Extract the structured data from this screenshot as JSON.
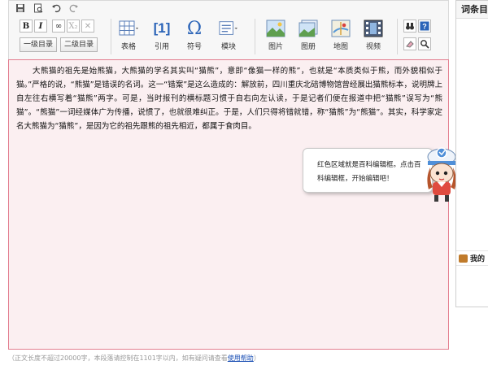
{
  "quickbar": {
    "icons": [
      "save-icon",
      "preview-icon",
      "undo-icon",
      "redo-icon"
    ]
  },
  "toolbar": {
    "format": {
      "bold": "B",
      "italic": "I",
      "link": "∞",
      "subscript": "X₂",
      "clear": "✕"
    },
    "heading1_label": "一级目录",
    "heading2_label": "二级目录",
    "table_label": "表格",
    "cite_label": "引用",
    "cite_glyph": "[1]",
    "symbol_label": "符号",
    "symbol_glyph": "Ω",
    "module_label": "模块",
    "image_label": "图片",
    "album_label": "图册",
    "map_label": "地图",
    "video_label": "视频"
  },
  "content": {
    "paragraph": "大熊猫的祖先是始熊猫，大熊猫的学名其实叫“猫熊”，意即“像猫一样的熊”，也就是“本质类似于熊，而外貌相似于猫。”严格的说，“熊猫”是错误的名词。这一“错案”是这么造成的：解放前，四川重庆北碚博物馆曾经展出猫熊标本，说明牌上自左往右横写着“猫熊”两字。可是，当时报刊的横标题习惯于自右向左认读，于是记者们便在报道中把“猫熊”误写为“熊猫”。“熊猫”一词经媒体广为传播，说惯了，也就很难纠正。于是，人们只得将错就错，称“猫熊”为“熊猫”。其实，科学家定名大熊猫为“猫熊”，是因为它的祖先跟熊的祖先相近，都属于食肉目。"
  },
  "tip": {
    "text": "红色区域就是百科编辑框。点击百科编辑框，开始编辑吧！"
  },
  "footer": {
    "text": "（正文长度不超过20000字，本段落请控制在1101字以内，如有疑问请查看",
    "link": "使用帮助",
    "close": "）"
  },
  "sidebar": {
    "header": "词条目",
    "section": "我的"
  },
  "colors": {
    "content_bg": "#fbeff1",
    "content_border": "#e37e8f",
    "link": "#1a4fb4"
  }
}
